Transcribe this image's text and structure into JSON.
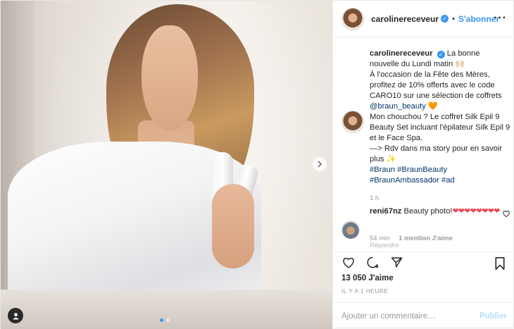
{
  "post": {
    "username": "carolinereceveur",
    "follow_label": "S'abonner",
    "separator": "•",
    "more_label": "···"
  },
  "caption": {
    "username": "carolinereceveur",
    "line1": "La bonne nouvelle du Lundi matin 🙌🏻",
    "line2": "À l'occasion de la Fête des Mères, profitez de 10% offerts avec le code CARO10 sur une sélection de coffrets",
    "mention": "@braun_beauty",
    "mention_suffix": " 🧡",
    "line3": "Mon chouchou ? Le coffret Silk Epil 9 Beauty Set incluant l'épilateur Silk Epil 9 et le Face Spa.",
    "line4": "—> Rdv dans ma story pour en savoir plus ✨",
    "hashtags": "#Braun #BraunBeauty #BraunAmbassador #ad",
    "time": "1 h"
  },
  "comment": {
    "username": "reni67nz",
    "text": "Beauty photo!",
    "hearts": "❤❤❤❤❤❤❤❤",
    "age": "54 min",
    "likes": "1 mention J'aime",
    "reply": "Répondre"
  },
  "stats": {
    "likes": "13 050 J'aime",
    "ago": "IL Y A 1 HEURE"
  },
  "add_comment": {
    "placeholder": "Ajouter un commentaire…",
    "publish_label": "Publier"
  },
  "colors": {
    "accent": "#3897f0",
    "heart": "#ed4956",
    "hashtag": "#003569"
  }
}
